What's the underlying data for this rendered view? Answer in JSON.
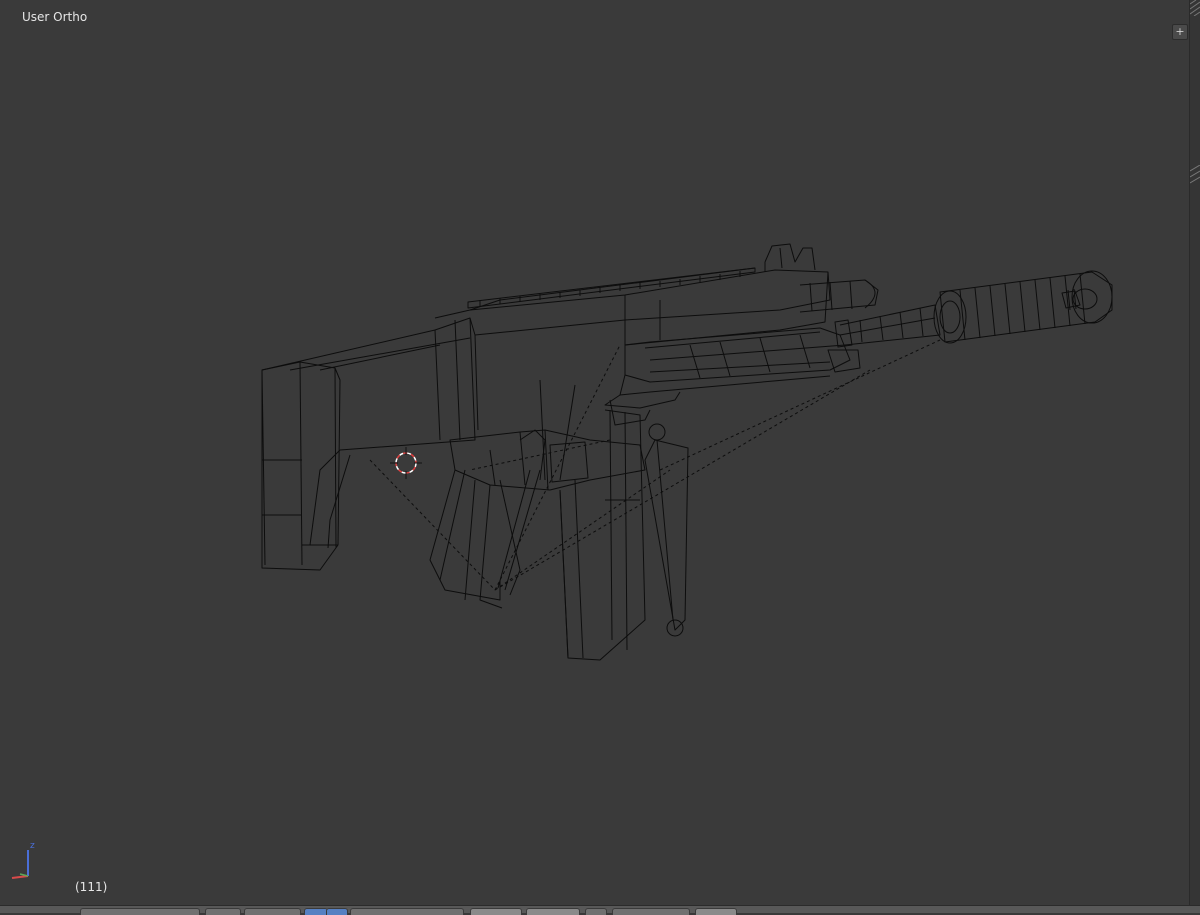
{
  "viewport": {
    "view_label": "User Ortho",
    "frame_label": "(111)",
    "props_toggle": "+"
  },
  "gizmo": {
    "z_label": "z"
  },
  "colors": {
    "background": "#3a3a3a",
    "wire": "#0d0d0d",
    "text": "#e6e6e6",
    "cursor_red": "#e04040"
  },
  "header": {
    "items": [
      "editor-type-menu",
      "view-menu",
      "mode-selector",
      "draw-type-selector",
      "pivot-selector",
      "manipulator-toggle",
      "layers",
      "snap-toggle",
      "proportional-toggle",
      "render-preview"
    ]
  }
}
